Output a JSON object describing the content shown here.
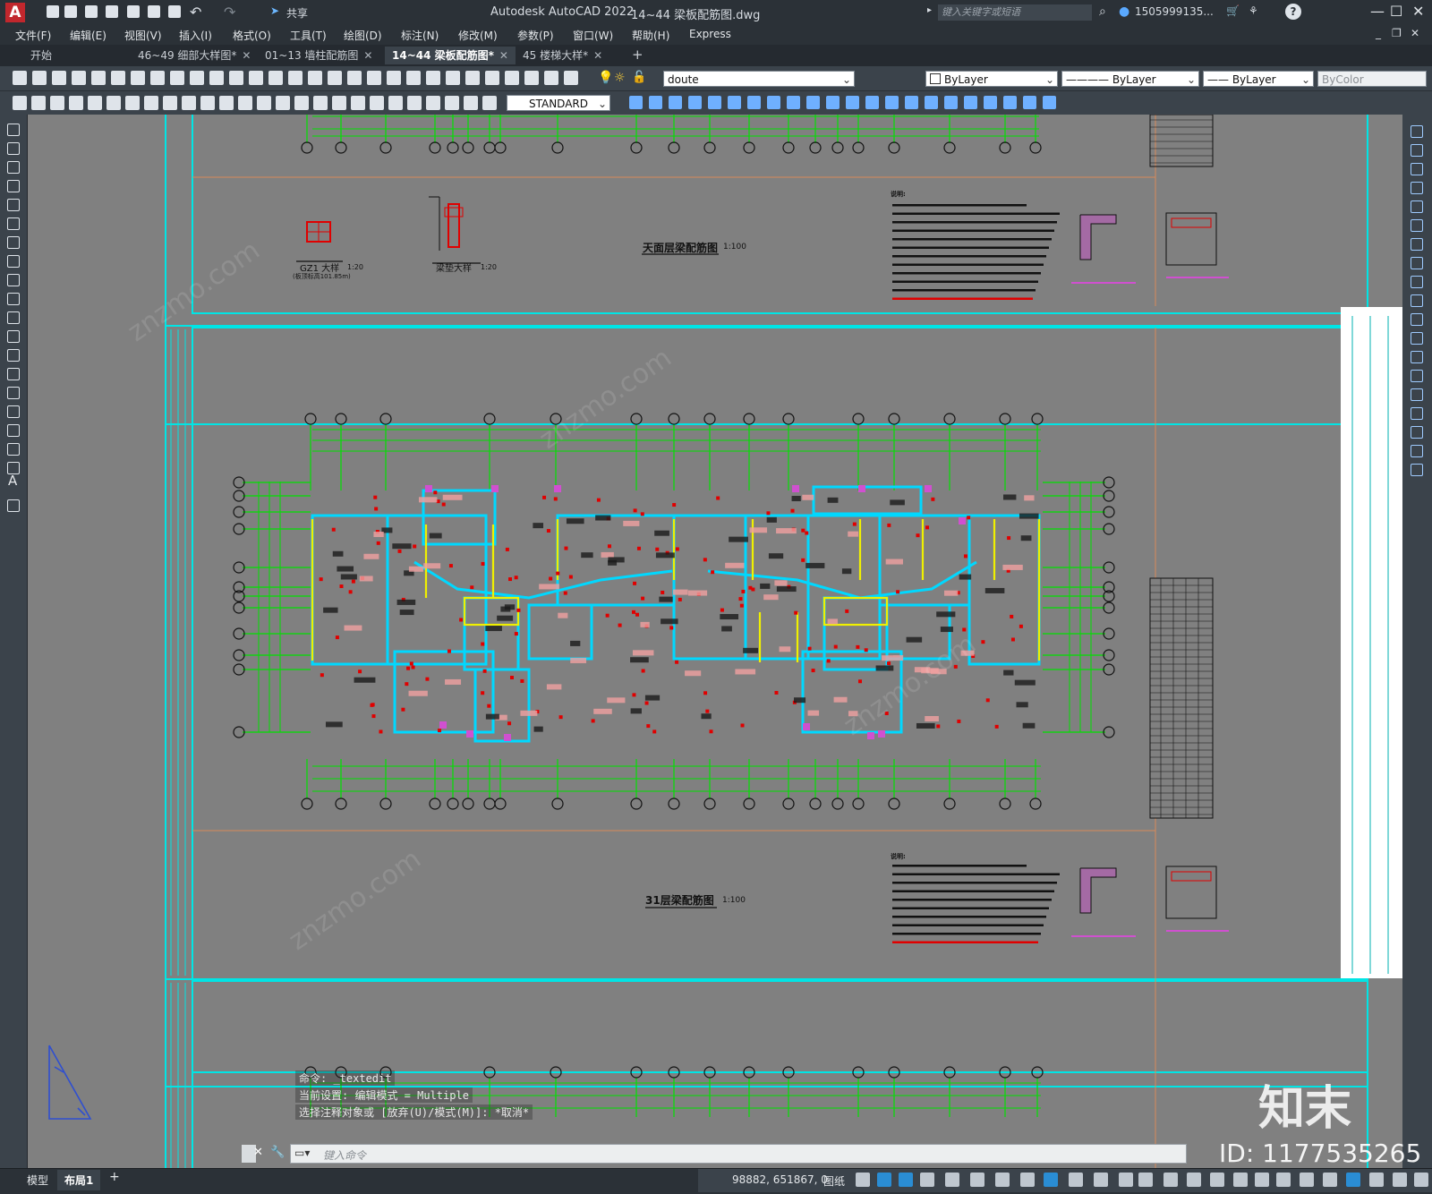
{
  "app": {
    "title": "Autodesk AutoCAD 2022",
    "file": "14~44  梁板配筋图.dwg",
    "share": "共享",
    "search_placeholder": "键入关键字或短语",
    "user": "1505999135...",
    "accent": "#00e5e5"
  },
  "menu": [
    "文件(F)",
    "编辑(E)",
    "视图(V)",
    "插入(I)",
    "格式(O)",
    "工具(T)",
    "绘图(D)",
    "标注(N)",
    "修改(M)",
    "参数(P)",
    "窗口(W)",
    "帮助(H)",
    "Express"
  ],
  "tabs": [
    {
      "label": "开始",
      "closable": false
    },
    {
      "label": "46~49 细部大样图*",
      "closable": true
    },
    {
      "label": "01~13  墙柱配筋图",
      "closable": true
    },
    {
      "label": "14~44  梁板配筋图*",
      "closable": true,
      "active": true
    },
    {
      "label": "45  楼梯大样*",
      "closable": true
    }
  ],
  "toolbar": {
    "layer": "doute",
    "color": "ByLayer",
    "linetype": "ByLayer",
    "lineweight": "ByLayer",
    "plotstyle": "ByColor",
    "textstyle": "STANDARD"
  },
  "drawing": {
    "top_title": "天面层梁配筋图",
    "top_scale": "1:100",
    "gz1_title": "GZ1 大样",
    "gz1_scale": "1:20",
    "gz1_note": "(板顶标高101.85m)",
    "liang_title": "梁垫大样",
    "liang_scale": "1:20",
    "main_title": "31层梁配筋图",
    "main_scale": "1:100",
    "notes_head": "说明:"
  },
  "command": {
    "history": [
      "命令: _textedit",
      "当前设置: 编辑模式 = Multiple",
      "选择注释对象或 [放弃(U)/模式(M)]: *取消*"
    ],
    "placeholder": "键入命令"
  },
  "layout_tabs": [
    "模型",
    "布局1"
  ],
  "status": {
    "coords": "98882, 651867, 0",
    "space": "图纸"
  },
  "watermark": {
    "brand": "知末",
    "id": "ID: 1177535265"
  }
}
